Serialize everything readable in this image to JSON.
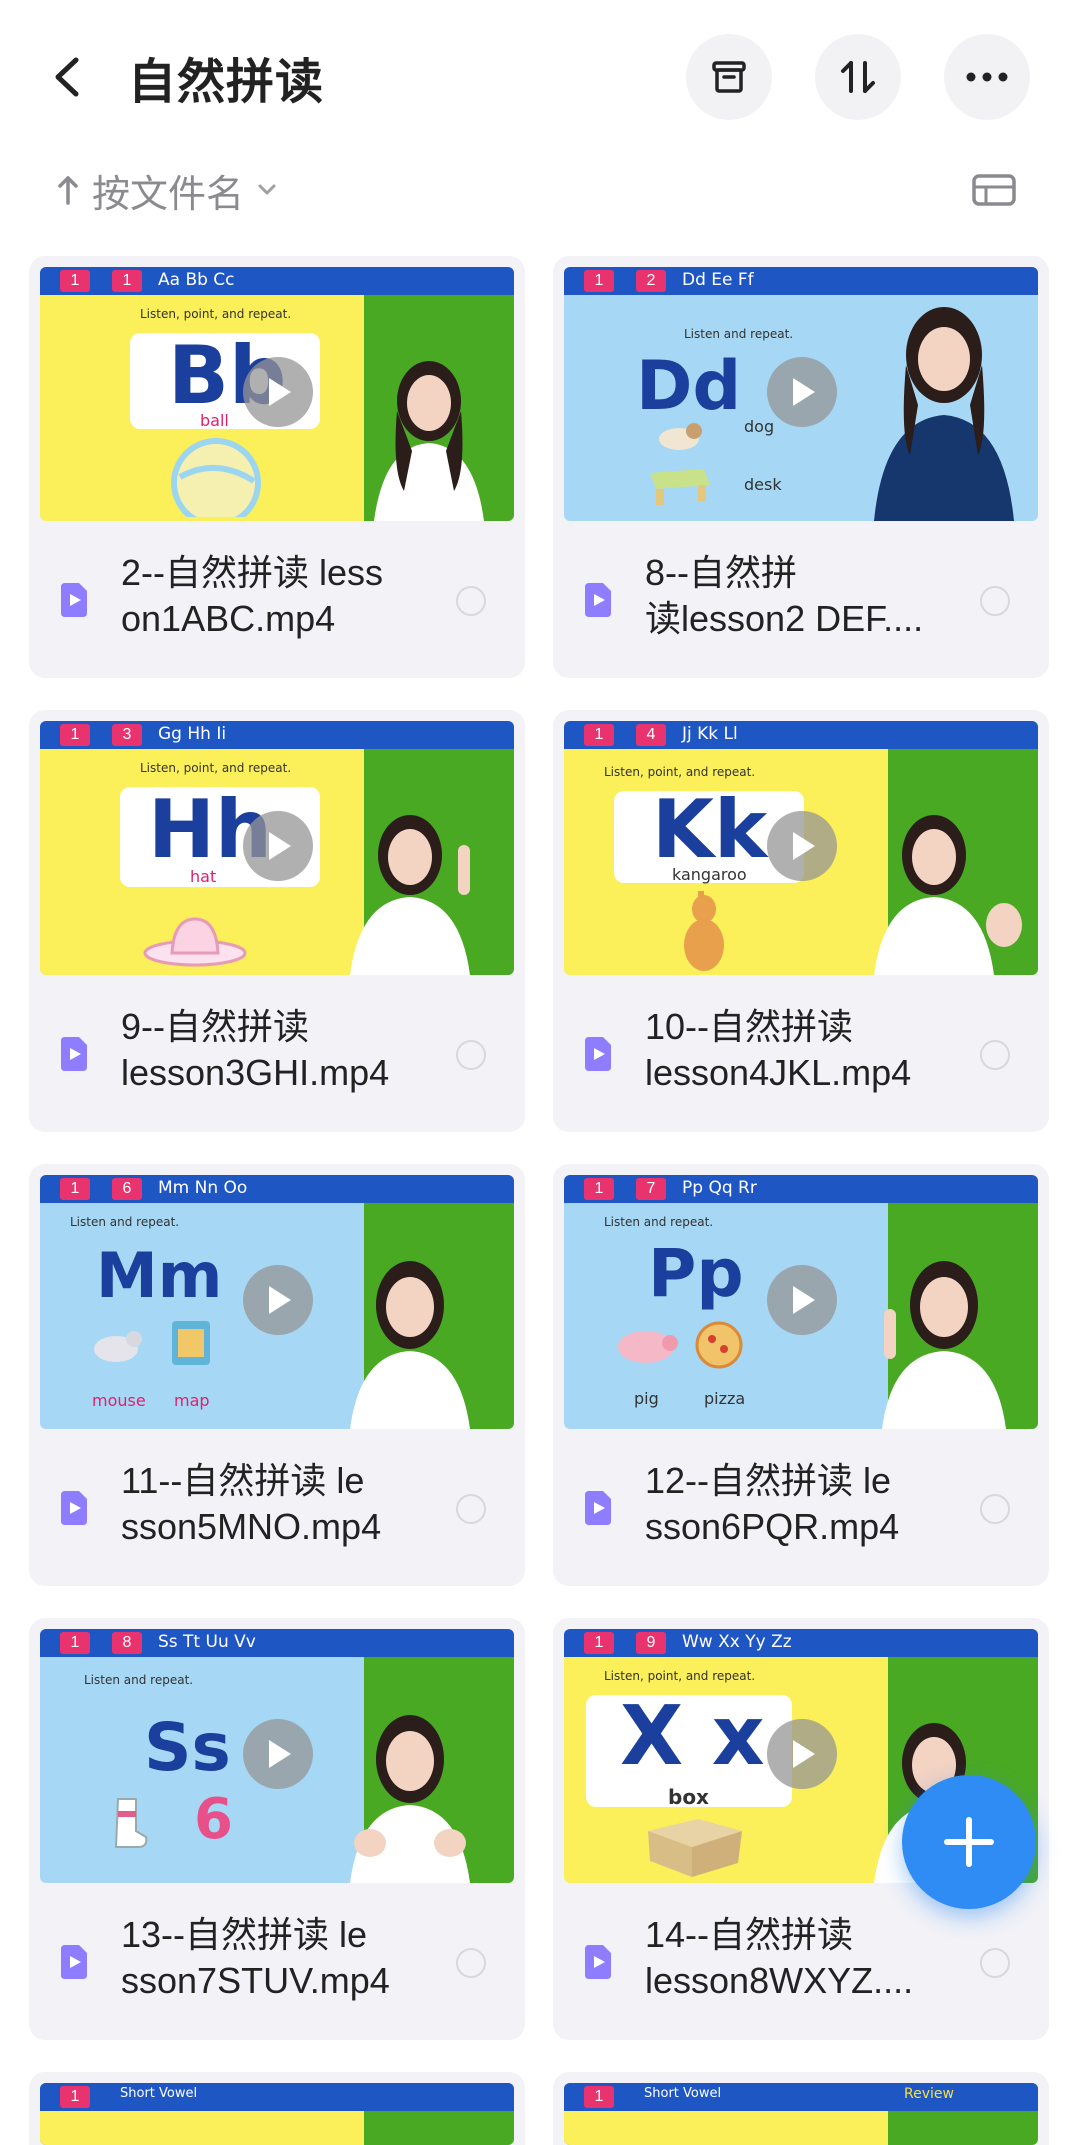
{
  "header": {
    "title": "自然拼读"
  },
  "sort": {
    "label": "按文件名"
  },
  "files": [
    {
      "name": "2--自然拼读 lesson1ABC.mp4",
      "display_line1": "2--自然拼读 less",
      "display_line2": "on1ABC.mp4",
      "unit_num": "1",
      "lesson_num": "1",
      "letters_bar": "Aa Bb Cc",
      "big_letters": "Bb",
      "word": "ball",
      "listen_text": "Listen, point, and repeat."
    },
    {
      "name": "8--自然拼读lesson2 DEF....",
      "display_line1": "8--自然拼",
      "display_line2": "读lesson2 DEF....",
      "unit_num": "1",
      "lesson_num": "2",
      "letters_bar": "Dd Ee Ff",
      "big_letters": "Dd",
      "word": "dog",
      "word2": "desk",
      "listen_text": "Listen and repeat."
    },
    {
      "name": "9--自然拼读 lesson3GHI.mp4",
      "display_line1": "9--自然拼读",
      "display_line2": "lesson3GHI.mp4",
      "unit_num": "1",
      "lesson_num": "3",
      "letters_bar": "Gg Hh Ii",
      "big_letters": "Hh",
      "word": "hat",
      "listen_text": "Listen, point, and repeat."
    },
    {
      "name": "10--自然拼读 lesson4JKL.mp4",
      "display_line1": "10--自然拼读",
      "display_line2": "lesson4JKL.mp4",
      "unit_num": "1",
      "lesson_num": "4",
      "letters_bar": "Jj Kk Ll",
      "big_letters": "Kk",
      "word": "kangaroo",
      "listen_text": "Listen, point, and repeat."
    },
    {
      "name": "11--自然拼读 lesson5MNO.mp4",
      "display_line1": "11--自然拼读 le",
      "display_line2": "sson5MNO.mp4",
      "unit_num": "1",
      "lesson_num": "6",
      "letters_bar": "Mm Nn Oo",
      "big_letters": "Mm",
      "word": "mouse",
      "word2": "map",
      "listen_text": "Listen and repeat."
    },
    {
      "name": "12--自然拼读 lesson6PQR.mp4",
      "display_line1": "12--自然拼读 le",
      "display_line2": "sson6PQR.mp4",
      "unit_num": "1",
      "lesson_num": "7",
      "letters_bar": "Pp Qq Rr",
      "big_letters": "Pp",
      "word": "pig",
      "word2": "pizza",
      "listen_text": "Listen and repeat."
    },
    {
      "name": "13--自然拼读 lesson7STUV.mp4",
      "display_line1": "13--自然拼读 le",
      "display_line2": "sson7STUV.mp4",
      "unit_num": "1",
      "lesson_num": "8",
      "letters_bar": "Ss Tt Uu Vv",
      "big_letters": "Ss",
      "word": "6",
      "listen_text": "Listen and repeat."
    },
    {
      "name": "14--自然拼读 lesson8WXYZ....",
      "display_line1": "14--自然拼读",
      "display_line2": "lesson8WXYZ....",
      "unit_num": "1",
      "lesson_num": "9",
      "letters_bar": "Ww Xx Yy Zz",
      "big_letters": "X x",
      "word": "box",
      "listen_text": "Listen, point, and repeat."
    }
  ],
  "partial_row": [
    {
      "unit_num": "1",
      "label": "Short Vowel"
    },
    {
      "unit_num": "1",
      "label": "Short Vowel",
      "extra": "Review"
    }
  ],
  "colors": {
    "accent": "#2f8cf5",
    "card_bg": "#f2f2f7",
    "file_icon": "#8f7dff",
    "thumb_yellow": "#fbef5a",
    "thumb_blue": "#a6d8f5",
    "thumb_green": "#4aa923",
    "thumb_bar": "#1e56c4"
  }
}
